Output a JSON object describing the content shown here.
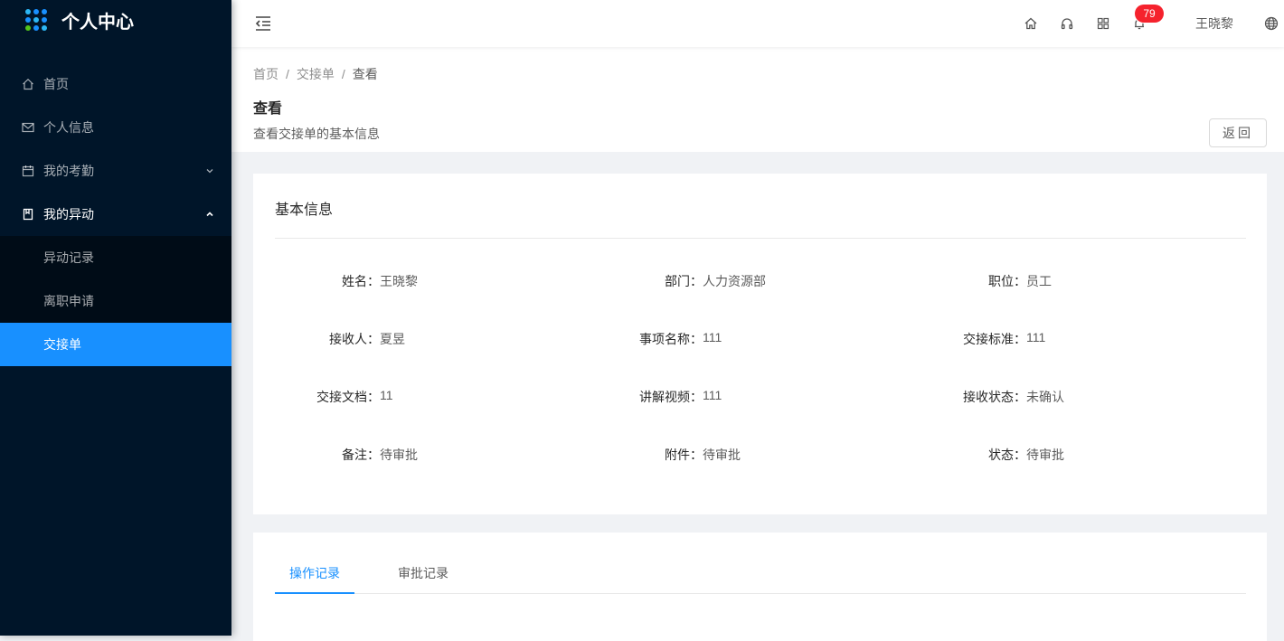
{
  "app": {
    "title": "个人中心"
  },
  "sidebar": {
    "items": [
      {
        "label": "首页"
      },
      {
        "label": "个人信息"
      },
      {
        "label": "我的考勤"
      },
      {
        "label": "我的异动"
      }
    ],
    "submenu": [
      {
        "label": "异动记录"
      },
      {
        "label": "离职申请"
      },
      {
        "label": "交接单"
      }
    ]
  },
  "header": {
    "notification_count": "79",
    "user_name": "王晓黎"
  },
  "breadcrumb": [
    "首页",
    "交接单",
    "查看"
  ],
  "page": {
    "title": "查看",
    "description": "查看交接单的基本信息",
    "back_label": "返回"
  },
  "basic_info": {
    "title": "基本信息",
    "fields": [
      {
        "label": "姓名：",
        "value": "王晓黎"
      },
      {
        "label": "部门：",
        "value": "人力资源部"
      },
      {
        "label": "职位：",
        "value": "员工"
      },
      {
        "label": "接收人：",
        "value": "夏昱"
      },
      {
        "label": "事项名称：",
        "value": "111"
      },
      {
        "label": "交接标准：",
        "value": "111"
      },
      {
        "label": "交接文档：",
        "value": "11"
      },
      {
        "label": "讲解视频：",
        "value": "111"
      },
      {
        "label": "接收状态：",
        "value": "未确认"
      },
      {
        "label": "备注：",
        "value": "待审批"
      },
      {
        "label": "附件：",
        "value": "待审批"
      },
      {
        "label": "状态：",
        "value": "待审批"
      }
    ]
  },
  "tabs": [
    {
      "label": "操作记录",
      "active": true
    },
    {
      "label": "审批记录",
      "active": false
    }
  ],
  "colors": {
    "primary": "#1890ff",
    "sider": "#001529",
    "badge": "#f5222d"
  }
}
